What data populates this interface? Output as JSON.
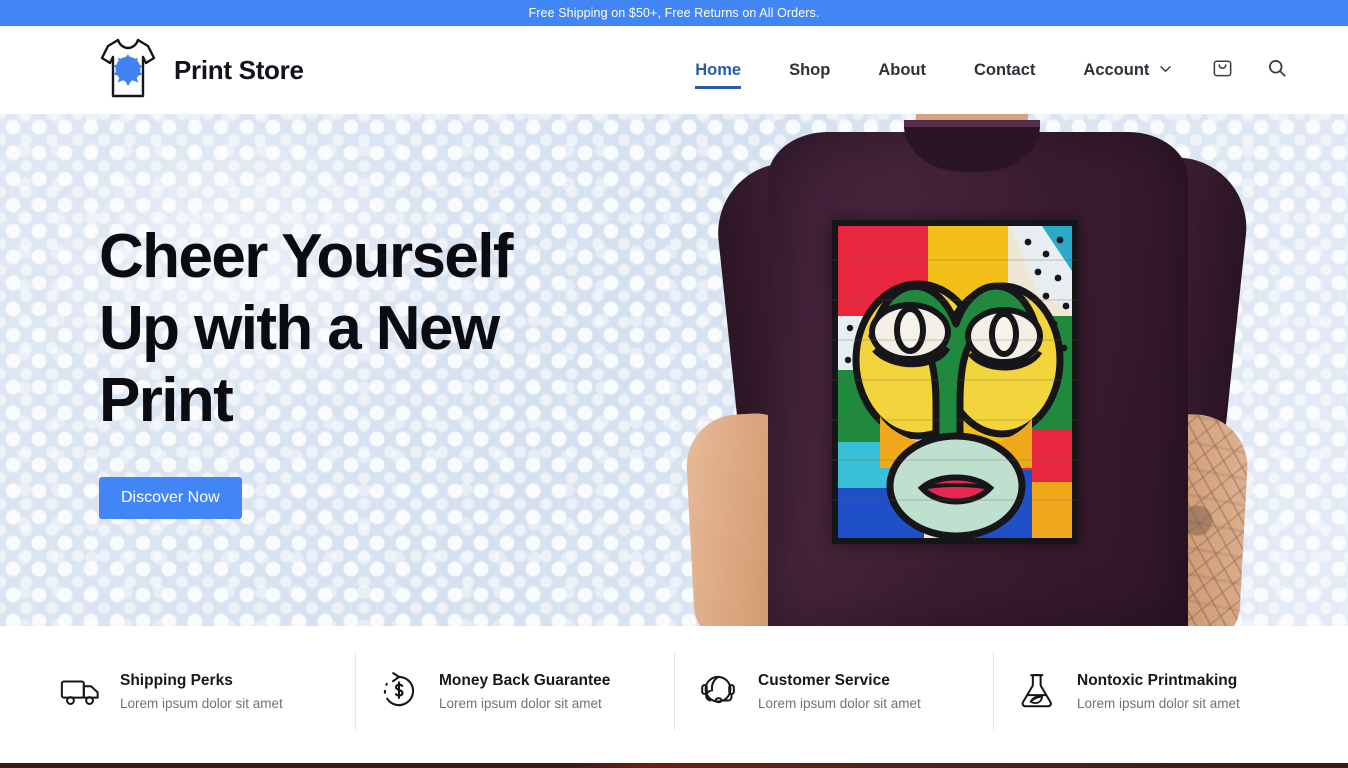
{
  "announcement": {
    "text": "Free Shipping on $50+, Free Returns on All Orders."
  },
  "header": {
    "brand_name": "Print Store",
    "logo_icon": "tshirt-paint-splat-icon",
    "nav": [
      {
        "label": "Home",
        "active": true,
        "icon": ""
      },
      {
        "label": "Shop",
        "active": false,
        "icon": ""
      },
      {
        "label": "About",
        "active": false,
        "icon": ""
      },
      {
        "label": "Contact",
        "active": false,
        "icon": ""
      },
      {
        "label": "Account",
        "active": false,
        "icon": "chevron-down-icon"
      }
    ],
    "cart_icon": "shopping-bag-icon",
    "search_icon": "search-icon"
  },
  "hero": {
    "title_lines": [
      "Cheer Yourself",
      "Up with a New",
      "Print"
    ],
    "title": "Cheer Yourself Up with a New Print",
    "cta_label": "Discover Now",
    "image_alt": "Man wearing dark purple t-shirt with colorful cubist face print"
  },
  "features": [
    {
      "icon": "delivery-truck-icon",
      "title": "Shipping Perks",
      "subtitle": "Lorem ipsum dolor sit amet"
    },
    {
      "icon": "money-back-icon",
      "title": "Money Back Guarantee",
      "subtitle": "Lorem ipsum dolor sit amet"
    },
    {
      "icon": "headset-icon",
      "title": "Customer Service",
      "subtitle": "Lorem ipsum dolor sit amet"
    },
    {
      "icon": "flask-leaf-icon",
      "title": "Nontoxic Printmaking",
      "subtitle": "Lorem ipsum dolor sit amet"
    }
  ],
  "colors": {
    "accent_blue": "#4285f4",
    "nav_active": "#2b5ca8",
    "hero_bg": "#d9e4f2",
    "text_dark": "#17171d",
    "text_muted": "#6f7278",
    "shirt": "#3a1c31"
  }
}
